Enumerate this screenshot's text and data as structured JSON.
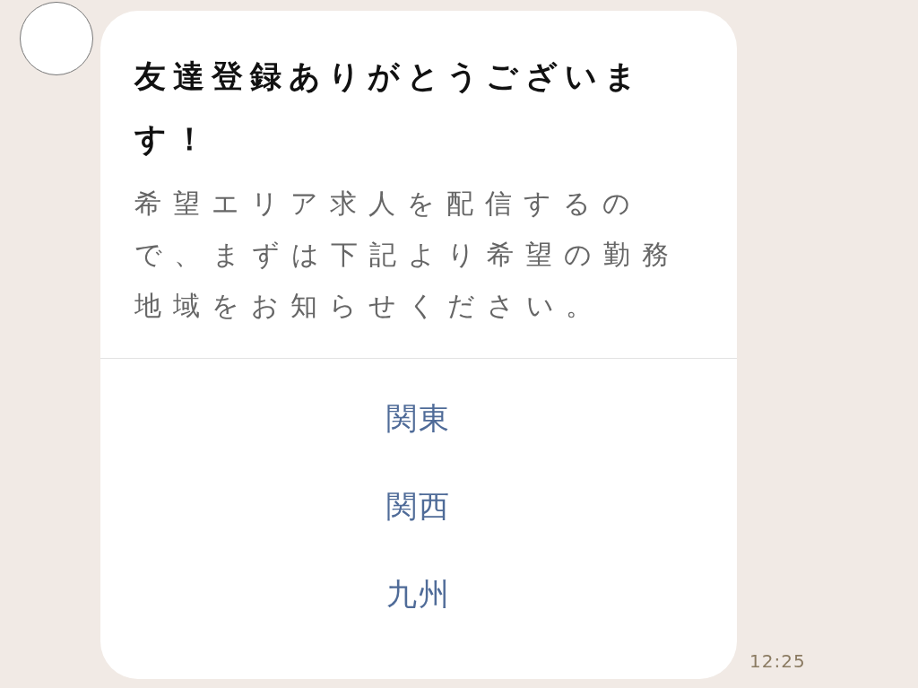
{
  "message": {
    "title": "友達登録ありがとうございます！",
    "body": "希望エリア求人を配信するので、まずは下記より希望の勤務地域をお知らせください。",
    "actions": [
      {
        "label": "関東"
      },
      {
        "label": "関西"
      },
      {
        "label": "九州"
      }
    ],
    "time": "12:25"
  }
}
